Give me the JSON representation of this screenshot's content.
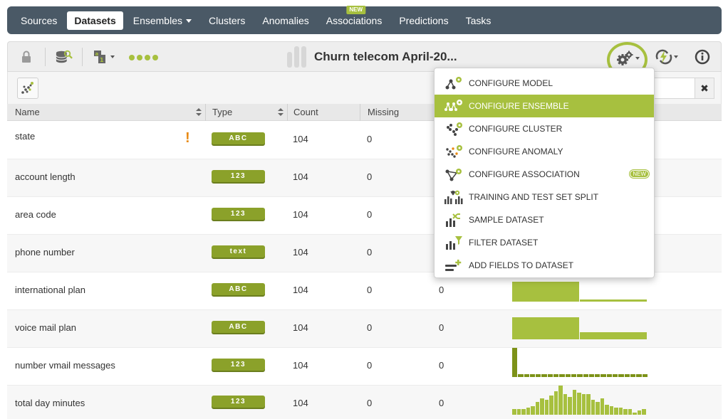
{
  "nav": {
    "items": [
      {
        "label": "Sources",
        "active": false
      },
      {
        "label": "Datasets",
        "active": true
      },
      {
        "label": "Ensembles",
        "active": false,
        "caret": true
      },
      {
        "label": "Clusters",
        "active": false
      },
      {
        "label": "Anomalies",
        "active": false
      },
      {
        "label": "Associations",
        "active": false,
        "badge": "NEW"
      },
      {
        "label": "Predictions",
        "active": false
      },
      {
        "label": "Tasks",
        "active": false
      }
    ]
  },
  "toolbar": {
    "dataset_title": "Churn telecom April-20...",
    "icons": [
      "lock-icon",
      "dataset-search-icon",
      "field-types-icon",
      "progress-dots",
      "configure-gear-icon",
      "one-click-model-icon",
      "info-icon"
    ]
  },
  "subbar": {
    "search_value": ""
  },
  "table": {
    "columns": {
      "name": "Name",
      "type": "Type",
      "count": "Count",
      "missing": "Missing"
    },
    "rows": [
      {
        "name": "state",
        "type": "ABC",
        "count": "104",
        "missing": "0",
        "errors": "",
        "warning": "!"
      },
      {
        "name": "account length",
        "type": "123",
        "count": "104",
        "missing": "0",
        "errors": ""
      },
      {
        "name": "area code",
        "type": "123",
        "count": "104",
        "missing": "0",
        "errors": ""
      },
      {
        "name": "phone number",
        "type": "text",
        "count": "104",
        "missing": "0",
        "errors": ""
      },
      {
        "name": "international plan",
        "type": "ABC",
        "count": "104",
        "missing": "0",
        "errors": "0"
      },
      {
        "name": "voice mail plan",
        "type": "ABC",
        "count": "104",
        "missing": "0",
        "errors": "0"
      },
      {
        "name": "number vmail messages",
        "type": "123",
        "count": "104",
        "missing": "0",
        "errors": "0"
      },
      {
        "name": "total day minutes",
        "type": "123",
        "count": "104",
        "missing": "0",
        "errors": "0"
      }
    ]
  },
  "histograms": {
    "international_plan": [
      0.82,
      0.08
    ],
    "voice_mail_plan": [
      0.75,
      0.25
    ],
    "number_vmail_messages": [
      1.0,
      0.1,
      0.1,
      0.1,
      0.1,
      0.1,
      0.1,
      0.1,
      0.1,
      0.1,
      0.1,
      0.1,
      0.1,
      0.1,
      0.1,
      0.1,
      0.1,
      0.1,
      0.1,
      0.1,
      0.1,
      0.1,
      0.1
    ],
    "total_day_minutes": [
      0.2,
      0.2,
      0.2,
      0.25,
      0.3,
      0.45,
      0.55,
      0.5,
      0.65,
      0.8,
      1.0,
      0.7,
      0.6,
      0.85,
      0.75,
      0.7,
      0.7,
      0.5,
      0.45,
      0.55,
      0.35,
      0.3,
      0.25,
      0.25,
      0.2,
      0.2,
      0.05,
      0.15,
      0.2
    ]
  },
  "dropdown": {
    "items": [
      {
        "label": "CONFIGURE MODEL",
        "icon": "model-gear-icon",
        "active": false
      },
      {
        "label": "CONFIGURE ENSEMBLE",
        "icon": "ensemble-gear-icon",
        "active": true
      },
      {
        "label": "CONFIGURE CLUSTER",
        "icon": "cluster-gear-icon",
        "active": false
      },
      {
        "label": "CONFIGURE ANOMALY",
        "icon": "anomaly-gear-icon",
        "active": false
      },
      {
        "label": "CONFIGURE ASSOCIATION",
        "icon": "association-gear-icon",
        "active": false,
        "badge": "NEW"
      },
      {
        "label": "TRAINING AND TEST SET SPLIT",
        "icon": "split-icon",
        "active": false
      },
      {
        "label": "SAMPLE DATASET",
        "icon": "sample-icon",
        "active": false
      },
      {
        "label": "FILTER DATASET",
        "icon": "filter-icon",
        "active": false
      },
      {
        "label": "ADD FIELDS TO DATASET",
        "icon": "add-fields-icon",
        "active": false
      }
    ]
  },
  "colors": {
    "accent": "#a7c03f",
    "nav_bg": "#4a5966",
    "badge_dark": "#8ba12a",
    "warning": "#e88a14"
  }
}
